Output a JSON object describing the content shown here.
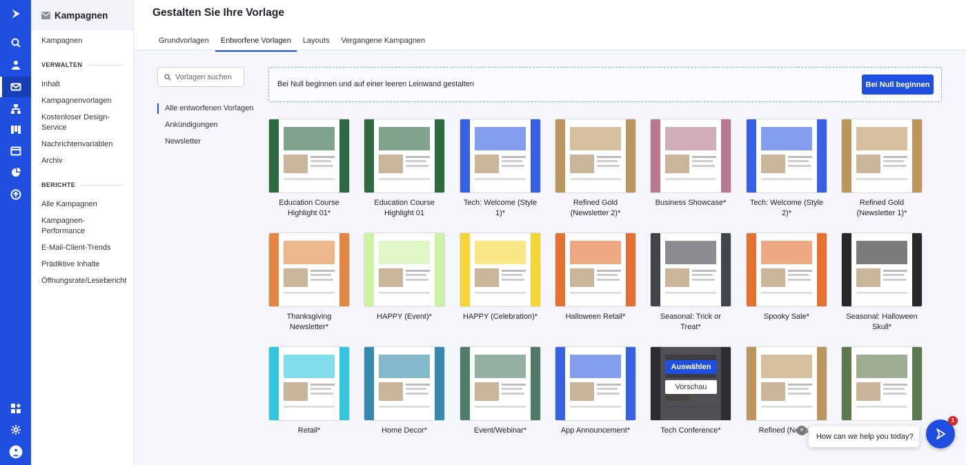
{
  "nav": {
    "header": "Kampagnen",
    "top_item": "Kampagnen",
    "sections": [
      {
        "title": "VERWALTEN",
        "items": [
          "Inhalt",
          "Kampagnenvorlagen",
          "Kostenloser Design-Service",
          "Nachrichtenvariablen",
          "Archiv"
        ]
      },
      {
        "title": "BERICHTE",
        "items": [
          "Alle Kampagnen",
          "Kampagnen-Performance",
          "E-Mail-Client-Trends",
          "Prädiktive Inhalte",
          "Öffnungsrate/Lesebericht"
        ]
      }
    ]
  },
  "page": {
    "title": "Gestalten Sie Ihre Vorlage",
    "tabs": [
      "Grundvorlagen",
      "Entworfene Vorlagen",
      "Layouts",
      "Vergangene Kampagnen"
    ],
    "active_tab": "Entworfene Vorlagen"
  },
  "search": {
    "placeholder": "Vorlagen suchen"
  },
  "filters": [
    "Alle entworfenen Vorlagen",
    "Ankündigungen",
    "Newsletter"
  ],
  "blank_canvas": {
    "text": "Bei Null beginnen und auf einer leeren Leinwand gestalten",
    "button": "Bei Null beginnen"
  },
  "templates": [
    {
      "name": "Education Course Highlight 01*",
      "theme": "#175a2c"
    },
    {
      "name": "Education Course Highlight 01",
      "theme": "#175a2c"
    },
    {
      "name": "Tech: Welcome (Style 1)*",
      "theme": "#1f4fe0"
    },
    {
      "name": "Refined Gold (Newsletter 2)*",
      "theme": "#b58a4a"
    },
    {
      "name": "Business Showcase*",
      "theme": "#b06a83"
    },
    {
      "name": "Tech: Welcome (Style 2)*",
      "theme": "#1f4fe0"
    },
    {
      "name": "Refined Gold (Newsletter 1)*",
      "theme": "#b58a4a"
    },
    {
      "name": "Thanksgiving Newsletter*",
      "theme": "#e07a2e"
    },
    {
      "name": "HAPPY (Event)*",
      "theme": "#c7f09a"
    },
    {
      "name": "HAPPY (Celebration)*",
      "theme": "#f4d21f"
    },
    {
      "name": "Halloween Retail*",
      "theme": "#e0611b"
    },
    {
      "name": "Seasonal: Trick or Treat*",
      "theme": "#2c2f36"
    },
    {
      "name": "Spooky Sale*",
      "theme": "#e0611b"
    },
    {
      "name": "Seasonal: Halloween Skull*",
      "theme": "#111111"
    },
    {
      "name": "Retail*",
      "theme": "#19c1d8"
    },
    {
      "name": "Home Decor*",
      "theme": "#1f7da0"
    },
    {
      "name": "Event/Webinar*",
      "theme": "#3a6d55"
    },
    {
      "name": "App Announcement*",
      "theme": "#1f4fe0"
    },
    {
      "name": "Tech Conference*",
      "theme": "#3a3f4b"
    },
    {
      "name": "Refined (Newsle",
      "theme": "#b58a4a"
    },
    {
      "name": "",
      "theme": "#4a6a3a"
    }
  ],
  "hover_actions": {
    "select": "Auswählen",
    "preview": "Vorschau"
  },
  "help": {
    "text": "How can we help you today?",
    "close": "×",
    "badge": "1"
  },
  "colors": {
    "brand": "#1f4fe0",
    "rail": "#1f4fe0"
  }
}
